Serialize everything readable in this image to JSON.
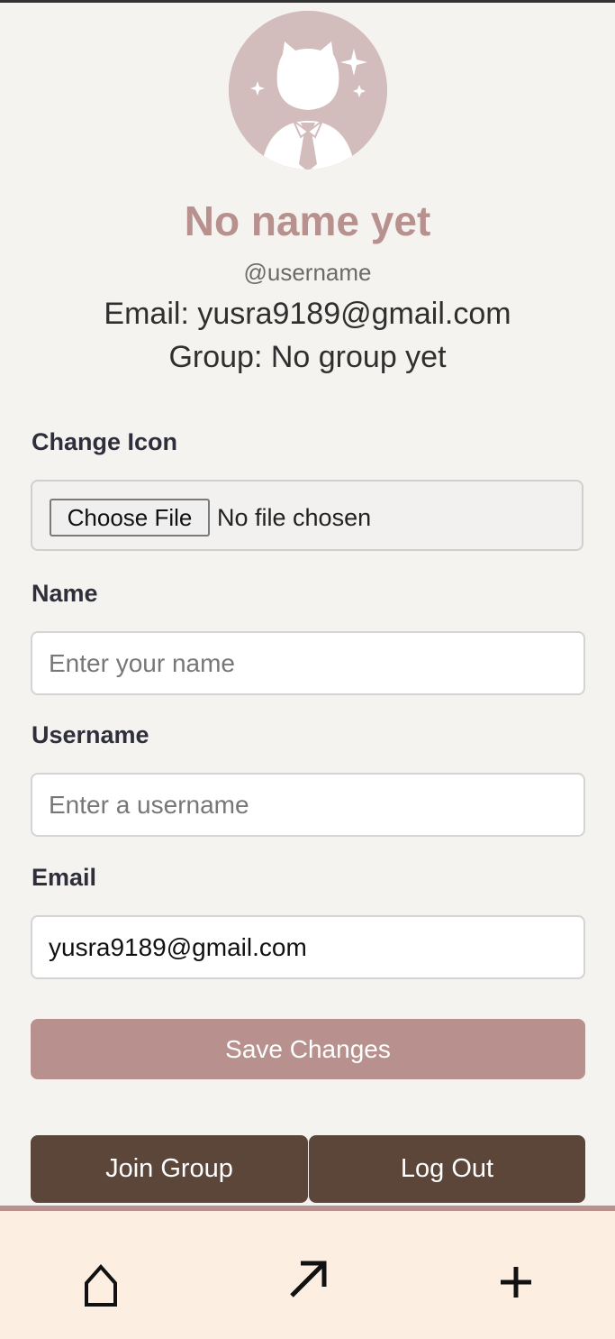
{
  "profile": {
    "display_name": "No name yet",
    "username": "@username",
    "email_line": "Email: yusra9189@gmail.com",
    "group_line": "Group: No group yet"
  },
  "form": {
    "change_icon_label": "Change Icon",
    "choose_file_label": "Choose File",
    "file_status": "No file chosen",
    "name_label": "Name",
    "name_placeholder": "Enter your name",
    "name_value": "",
    "username_label": "Username",
    "username_placeholder": "Enter a username",
    "username_value": "",
    "email_label": "Email",
    "email_value": "yusra9189@gmail.com",
    "save_label": "Save Changes"
  },
  "actions": {
    "join_group_label": "Join Group",
    "log_out_label": "Log Out"
  },
  "nav": {
    "items": [
      {
        "icon": "home-icon"
      },
      {
        "icon": "arrow-up-right-icon"
      },
      {
        "icon": "plus-icon"
      }
    ]
  },
  "colors": {
    "accent": "#b8908e",
    "dark_button": "#5c463a",
    "nav_background": "#fcefe2",
    "page_background": "#f5f3f0",
    "avatar_background": "#d3bcbc"
  }
}
